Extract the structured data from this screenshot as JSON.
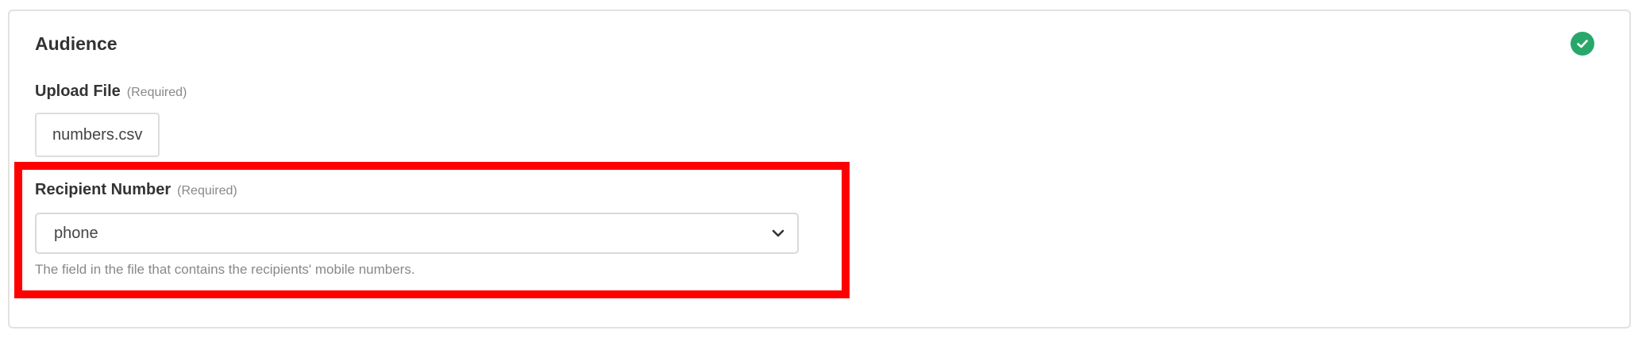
{
  "section": {
    "title": "Audience",
    "status_icon": "check-circle-icon",
    "status_color": "#27a86a"
  },
  "upload_file": {
    "label": "Upload File",
    "required": "(Required)",
    "value": "numbers.csv"
  },
  "recipient_number": {
    "label": "Recipient Number",
    "required": "(Required)",
    "selected": "phone",
    "help": "The field in the file that contains the recipients' mobile numbers."
  },
  "highlight_color": "#ff0000"
}
